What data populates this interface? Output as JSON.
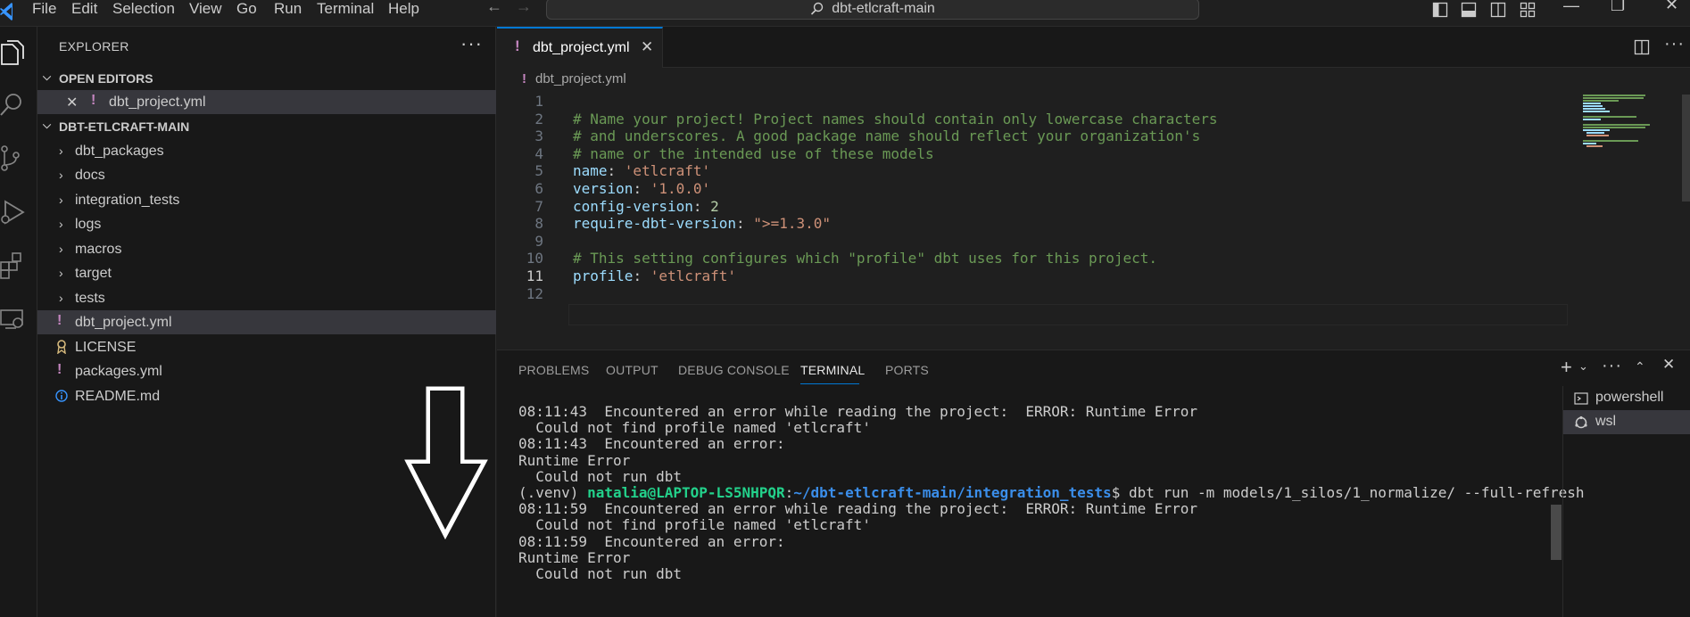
{
  "titlebar": {
    "menu": [
      "File",
      "Edit",
      "Selection",
      "View",
      "Go",
      "Run",
      "Terminal",
      "Help"
    ],
    "search_text": "dbt-etlcraft-main",
    "back_icon": "arrow-left-icon",
    "forward_icon": "arrow-right-icon"
  },
  "sidebar": {
    "header": "EXPLORER",
    "more": "···",
    "open_editors_label": "OPEN EDITORS",
    "open_editors": [
      {
        "name": "dbt_project.yml",
        "icon": "!"
      }
    ],
    "project_label": "DBT-ETLCRAFT-MAIN",
    "folders": [
      "dbt_packages",
      "docs",
      "integration_tests",
      "logs",
      "macros",
      "target",
      "tests"
    ],
    "files": [
      {
        "name": "dbt_project.yml",
        "icon": "!",
        "selected": true
      },
      {
        "name": "LICENSE",
        "icon": "license-icon"
      },
      {
        "name": "packages.yml",
        "icon": "!"
      },
      {
        "name": "README.md",
        "icon": "info-icon"
      }
    ]
  },
  "editor": {
    "tab_label": "dbt_project.yml",
    "tab_icon": "!",
    "breadcrumb": "dbt_project.yml",
    "active_line": 11,
    "lines": [
      {
        "n": "1",
        "tokens": []
      },
      {
        "n": "2",
        "tokens": [
          {
            "t": "# Name your project! Project names should contain only lowercase characters",
            "c": "cmt"
          }
        ]
      },
      {
        "n": "3",
        "tokens": [
          {
            "t": "# and underscores. A good package name should reflect your organization's",
            "c": "cmt"
          }
        ]
      },
      {
        "n": "4",
        "tokens": [
          {
            "t": "# name or the intended use of these models",
            "c": "cmt"
          }
        ]
      },
      {
        "n": "5",
        "tokens": [
          {
            "t": "name",
            "c": "key"
          },
          {
            "t": ": ",
            "c": "pun"
          },
          {
            "t": "'etlcraft'",
            "c": "str"
          }
        ]
      },
      {
        "n": "6",
        "tokens": [
          {
            "t": "version",
            "c": "key"
          },
          {
            "t": ": ",
            "c": "pun"
          },
          {
            "t": "'1.0.0'",
            "c": "str"
          }
        ]
      },
      {
        "n": "7",
        "tokens": [
          {
            "t": "config-version",
            "c": "key"
          },
          {
            "t": ": ",
            "c": "pun"
          },
          {
            "t": "2",
            "c": "numv"
          }
        ]
      },
      {
        "n": "8",
        "tokens": [
          {
            "t": "require-dbt-version",
            "c": "key"
          },
          {
            "t": ": ",
            "c": "pun"
          },
          {
            "t": "\">=1.3.0\"",
            "c": "str"
          }
        ]
      },
      {
        "n": "9",
        "tokens": []
      },
      {
        "n": "10",
        "tokens": [
          {
            "t": "# This setting configures which \"profile\" dbt uses for this project.",
            "c": "cmt"
          }
        ]
      },
      {
        "n": "11",
        "tokens": [
          {
            "t": "profile",
            "c": "key"
          },
          {
            "t": ": ",
            "c": "pun"
          },
          {
            "t": "'etlcraft'",
            "c": "str"
          }
        ]
      },
      {
        "n": "12",
        "tokens": []
      }
    ]
  },
  "panel": {
    "tabs": [
      "PROBLEMS",
      "OUTPUT",
      "DEBUG CONSOLE",
      "TERMINAL",
      "PORTS"
    ],
    "active_tab": "TERMINAL",
    "terminal_lines": [
      {
        "segments": [
          {
            "t": "08:11:43  Encountered an error while reading the project:  ERROR: Runtime Error",
            "c": ""
          }
        ]
      },
      {
        "segments": [
          {
            "t": "  Could not find profile named 'etlcraft'",
            "c": ""
          }
        ]
      },
      {
        "segments": [
          {
            "t": "08:11:43  Encountered an error:",
            "c": ""
          }
        ]
      },
      {
        "segments": [
          {
            "t": "Runtime Error",
            "c": ""
          }
        ]
      },
      {
        "segments": [
          {
            "t": "  Could not run dbt",
            "c": ""
          }
        ]
      },
      {
        "segments": [
          {
            "t": "(.venv) ",
            "c": ""
          },
          {
            "t": "natalia@LAPTOP-LS5NHPQR",
            "c": "tgreen"
          },
          {
            "t": ":",
            "c": ""
          },
          {
            "t": "~/dbt-etlcraft-main/integration_tests",
            "c": "tblue"
          },
          {
            "t": "$ dbt run -m models/1_silos/1_normalize/ --full-refresh",
            "c": ""
          }
        ]
      },
      {
        "segments": [
          {
            "t": "08:11:59  Encountered an error while reading the project:  ERROR: Runtime Error",
            "c": ""
          }
        ]
      },
      {
        "segments": [
          {
            "t": "  Could not find profile named 'etlcraft'",
            "c": ""
          }
        ]
      },
      {
        "segments": [
          {
            "t": "08:11:59  Encountered an error:",
            "c": ""
          }
        ]
      },
      {
        "segments": [
          {
            "t": "Runtime Error",
            "c": ""
          }
        ]
      },
      {
        "segments": [
          {
            "t": "  Could not run dbt",
            "c": ""
          }
        ]
      }
    ],
    "terminals": [
      {
        "name": "powershell",
        "icon": "terminal-icon",
        "selected": false
      },
      {
        "name": "wsl",
        "icon": "linux-icon",
        "selected": true
      }
    ]
  },
  "colors": {
    "accent": "#0078d4",
    "yaml_bang": "#c586c0"
  }
}
